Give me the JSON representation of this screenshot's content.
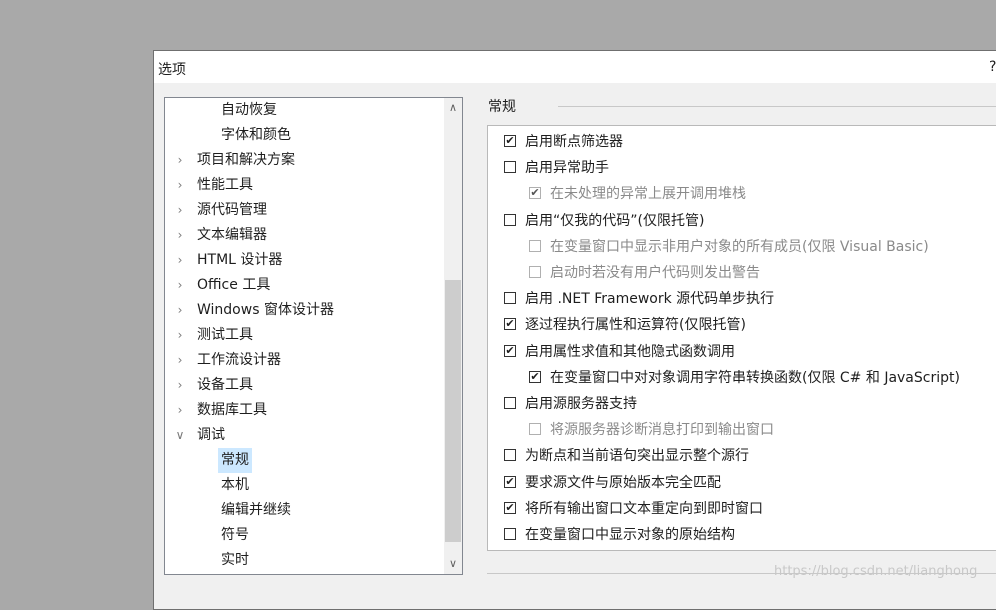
{
  "dialog": {
    "title": "选项",
    "help": "?"
  },
  "tree": {
    "items": [
      {
        "label": "自动恢复",
        "level": 1,
        "expander": ""
      },
      {
        "label": "字体和颜色",
        "level": 1,
        "expander": ""
      },
      {
        "label": "项目和解决方案",
        "level": 0,
        "expander": ">"
      },
      {
        "label": "性能工具",
        "level": 0,
        "expander": ">"
      },
      {
        "label": "源代码管理",
        "level": 0,
        "expander": ">"
      },
      {
        "label": "文本编辑器",
        "level": 0,
        "expander": ">"
      },
      {
        "label": "HTML 设计器",
        "level": 0,
        "expander": ">"
      },
      {
        "label": "Office 工具",
        "level": 0,
        "expander": ">"
      },
      {
        "label": "Windows 窗体设计器",
        "level": 0,
        "expander": ">"
      },
      {
        "label": "测试工具",
        "level": 0,
        "expander": ">"
      },
      {
        "label": "工作流设计器",
        "level": 0,
        "expander": ">"
      },
      {
        "label": "设备工具",
        "level": 0,
        "expander": ">"
      },
      {
        "label": "数据库工具",
        "level": 0,
        "expander": ">"
      },
      {
        "label": "调试",
        "level": 0,
        "expander": "v"
      },
      {
        "label": "常规",
        "level": 1,
        "expander": "",
        "selected": true
      },
      {
        "label": "本机",
        "level": 1,
        "expander": ""
      },
      {
        "label": "编辑并继续",
        "level": 1,
        "expander": ""
      },
      {
        "label": "符号",
        "level": 1,
        "expander": ""
      },
      {
        "label": "实时",
        "level": 1,
        "expander": ""
      }
    ]
  },
  "section": {
    "header": "常规"
  },
  "options": [
    {
      "label": "启用断点筛选器",
      "checked": true,
      "indent": 0,
      "enabled": true
    },
    {
      "label": "启用异常助手",
      "checked": false,
      "indent": 0,
      "enabled": true
    },
    {
      "label": "在未处理的异常上展开调用堆栈",
      "checked": true,
      "indent": 1,
      "enabled": false
    },
    {
      "label": "启用“仅我的代码”(仅限托管)",
      "checked": false,
      "indent": 0,
      "enabled": true
    },
    {
      "label": "在变量窗口中显示非用户对象的所有成员(仅限 Visual Basic)",
      "checked": false,
      "indent": 1,
      "enabled": false
    },
    {
      "label": "启动时若没有用户代码则发出警告",
      "checked": false,
      "indent": 1,
      "enabled": false
    },
    {
      "label": "启用 .NET Framework 源代码单步执行",
      "checked": false,
      "indent": 0,
      "enabled": true
    },
    {
      "label": "逐过程执行属性和运算符(仅限托管)",
      "checked": true,
      "indent": 0,
      "enabled": true
    },
    {
      "label": "启用属性求值和其他隐式函数调用",
      "checked": true,
      "indent": 0,
      "enabled": true
    },
    {
      "label": "在变量窗口中对对象调用字符串转换函数(仅限 C# 和 JavaScript)",
      "checked": true,
      "indent": 1,
      "enabled": true
    },
    {
      "label": "启用源服务器支持",
      "checked": false,
      "indent": 0,
      "enabled": true
    },
    {
      "label": "将源服务器诊断消息打印到输出窗口",
      "checked": false,
      "indent": 1,
      "enabled": false
    },
    {
      "label": "为断点和当前语句突出显示整个源行",
      "checked": false,
      "indent": 0,
      "enabled": true
    },
    {
      "label": "要求源文件与原始版本完全匹配",
      "checked": true,
      "indent": 0,
      "enabled": true
    },
    {
      "label": "将所有输出窗口文本重定向到即时窗口",
      "checked": true,
      "indent": 0,
      "enabled": true
    },
    {
      "label": "在变量窗口中显示对象的原始结构",
      "checked": false,
      "indent": 0,
      "enabled": true
    }
  ],
  "scrollbar": {
    "up": "^",
    "down": "v"
  },
  "watermark": "https://blog.csdn.net/lianghong"
}
